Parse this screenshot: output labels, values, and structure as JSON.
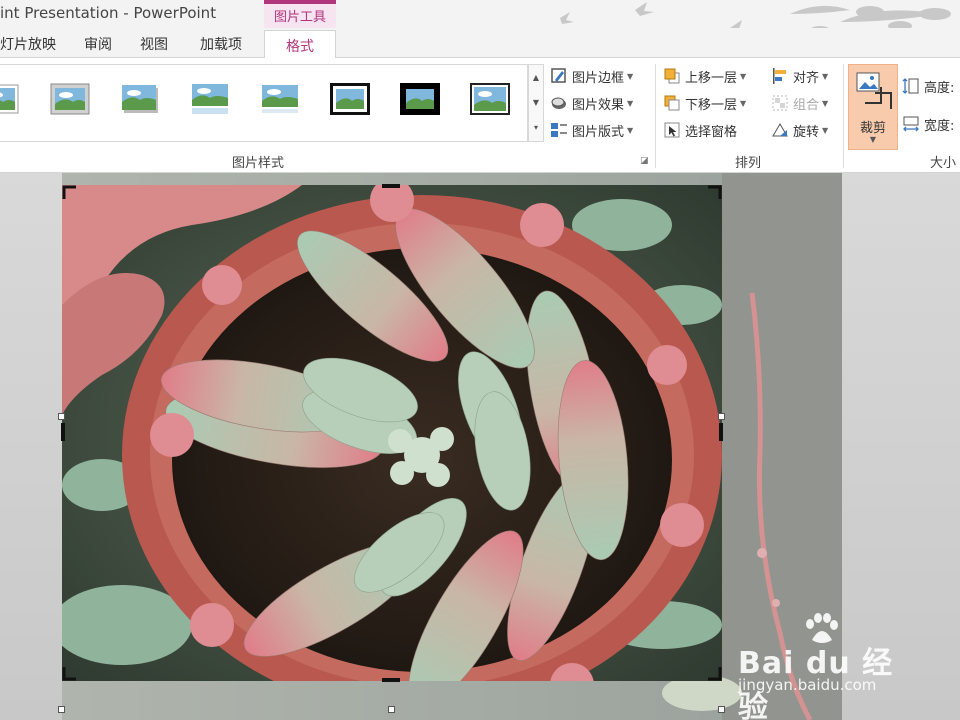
{
  "window": {
    "title": "int Presentation - PowerPoint",
    "contextual_tab_group": "图片工具"
  },
  "tabs": [
    {
      "label": "灯片放映",
      "active": false
    },
    {
      "label": "审阅",
      "active": false
    },
    {
      "label": "视图",
      "active": false
    },
    {
      "label": "加载项",
      "active": false
    },
    {
      "label": "格式",
      "active": true
    }
  ],
  "ribbon": {
    "picture_styles": {
      "label": "图片样式",
      "gallery_items": [
        "simple-frame",
        "soft-edge",
        "drop-shadow",
        "reflected",
        "reflected-soft",
        "thick-frame",
        "black-frame",
        "thin-frame"
      ],
      "commands": [
        {
          "label": "图片边框",
          "icon": "picture-border-icon"
        },
        {
          "label": "图片效果",
          "icon": "picture-effects-icon"
        },
        {
          "label": "图片版式",
          "icon": "picture-layout-icon"
        }
      ]
    },
    "arrange": {
      "label": "排列",
      "commands": [
        {
          "label": "上移一层",
          "icon": "bring-forward-icon",
          "enabled": true
        },
        {
          "label": "下移一层",
          "icon": "send-backward-icon",
          "enabled": true
        },
        {
          "label": "选择窗格",
          "icon": "selection-pane-icon",
          "enabled": true
        },
        {
          "label": "对齐",
          "icon": "align-icon",
          "enabled": true
        },
        {
          "label": "组合",
          "icon": "group-icon",
          "enabled": false
        },
        {
          "label": "旋转",
          "icon": "rotate-icon",
          "enabled": true
        }
      ]
    },
    "size": {
      "label": "大小",
      "crop_label": "裁剪",
      "height_label": "高度:",
      "width_label": "宽度:"
    }
  },
  "watermark": {
    "brand": "Bai du 经验",
    "url": "jingyan.baidu.com"
  },
  "colors": {
    "accent": "#b0357a",
    "contextual_tab_bg": "#f7e4f1",
    "crop_button_bg": "#f8cbad",
    "ribbon_bg": "#ffffff",
    "slide_area_bg": "#d0d0d0"
  }
}
